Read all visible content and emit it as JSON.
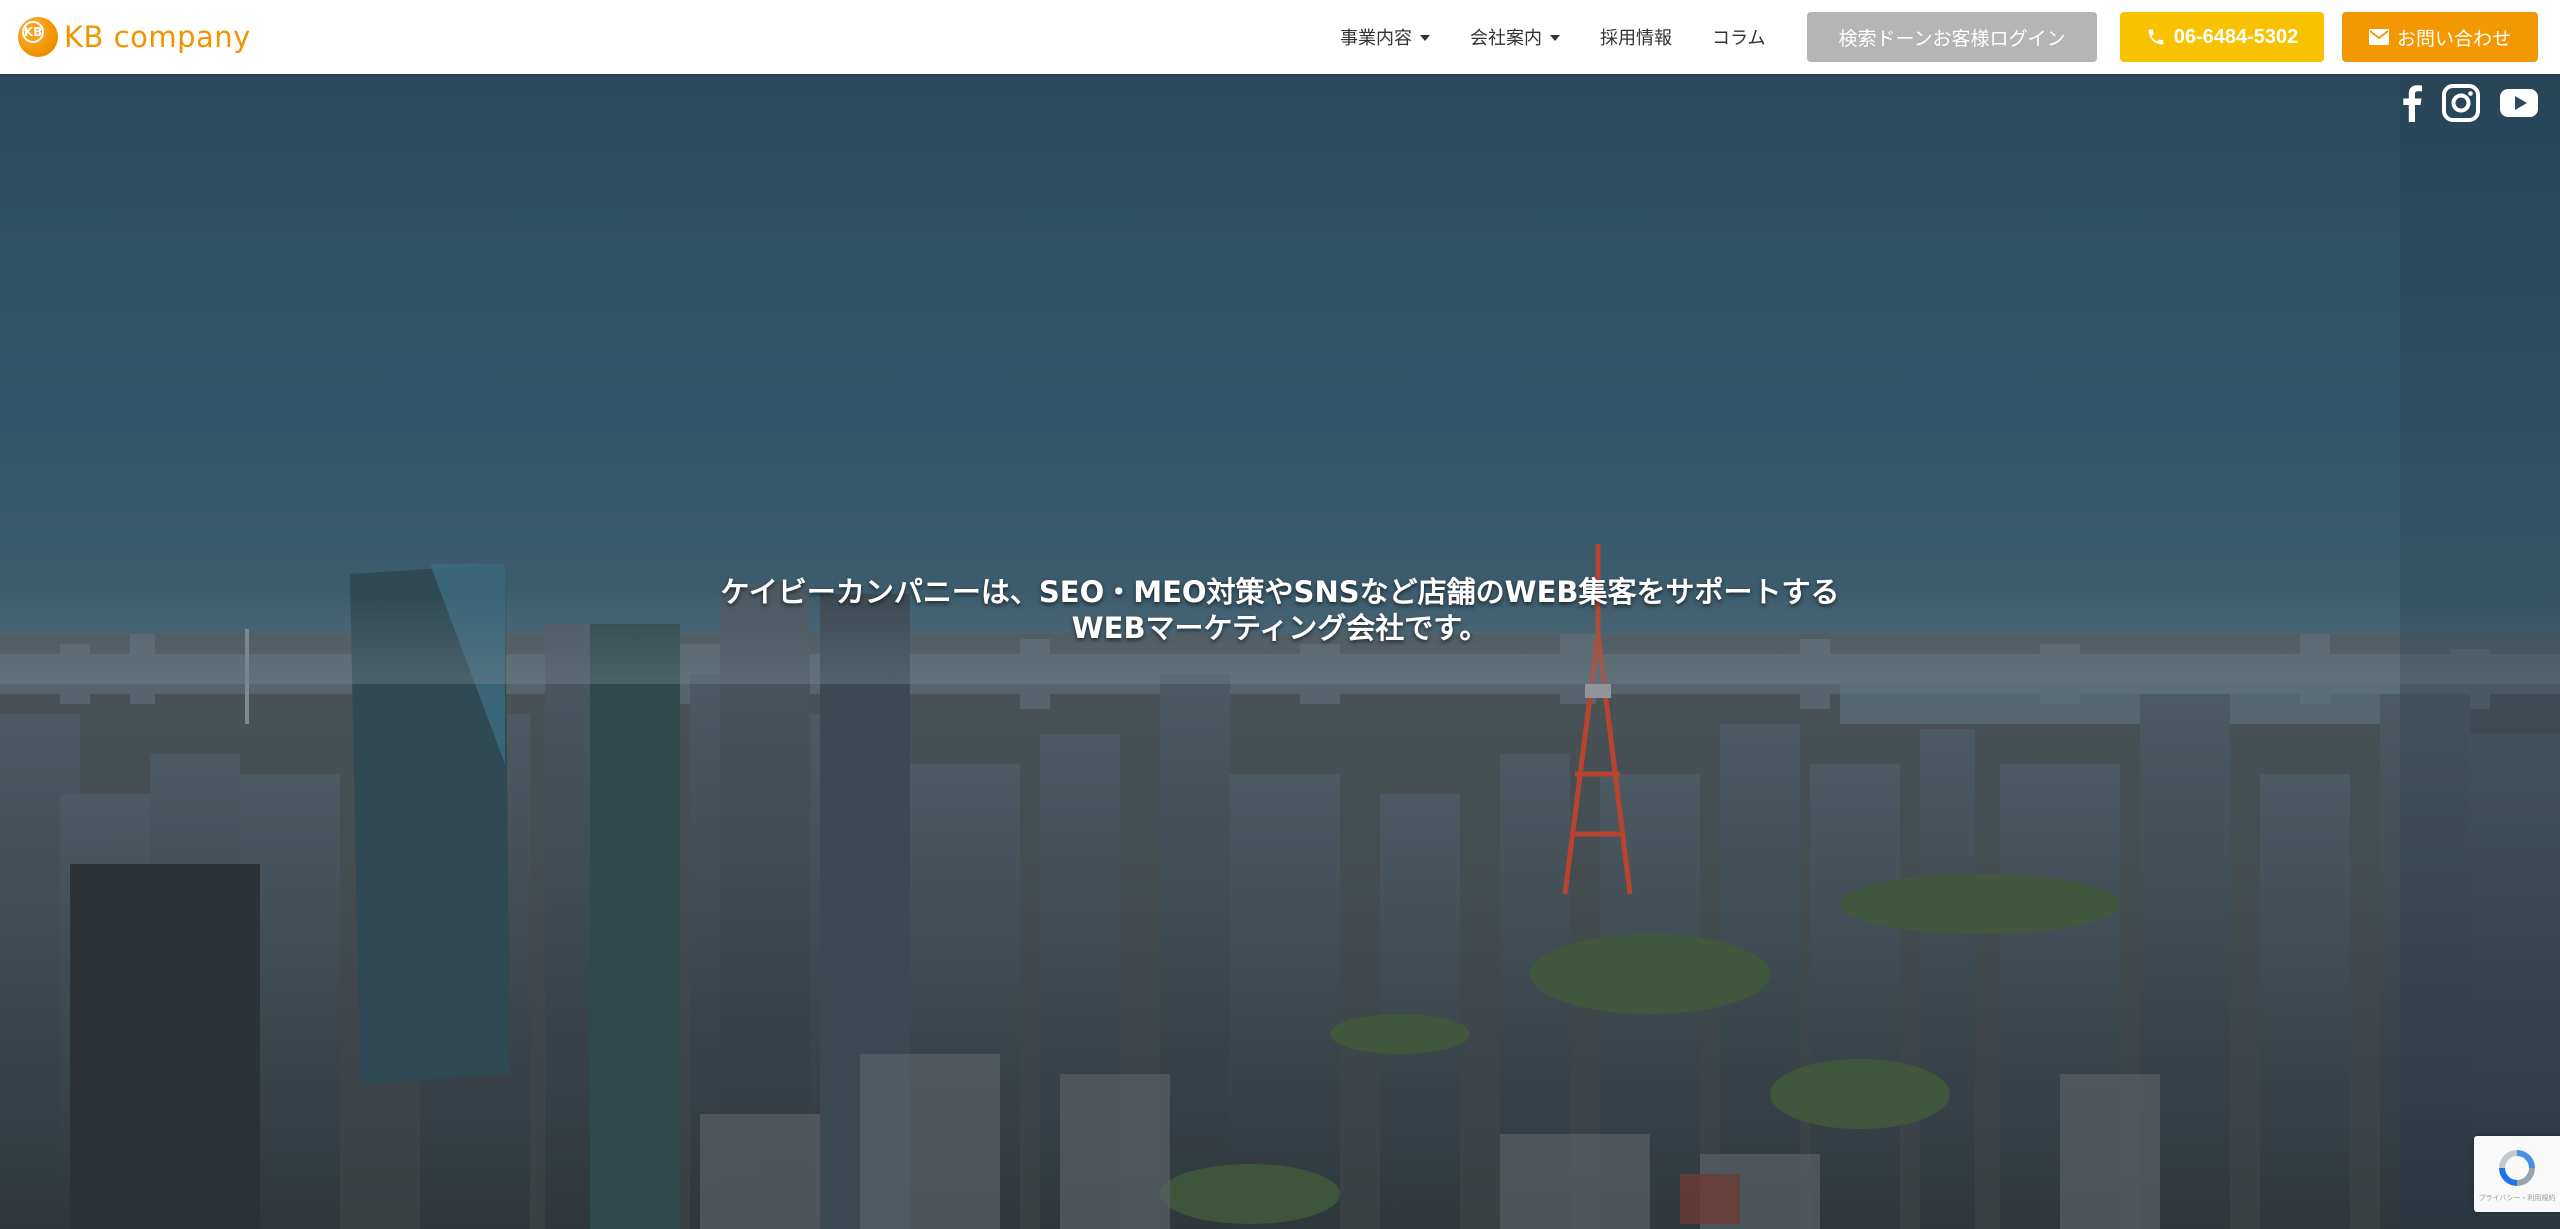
{
  "header": {
    "logo_mark": "KB",
    "logo_text": "KB company",
    "nav": [
      {
        "label": "事業内容",
        "dropdown": true
      },
      {
        "label": "会社案内",
        "dropdown": true
      },
      {
        "label": "採用情報",
        "dropdown": false
      },
      {
        "label": "コラム",
        "dropdown": false
      }
    ],
    "login_button": "検索ドーンお客様ログイン",
    "phone_button": "06-6484-5302",
    "contact_button": "お問い合わせ"
  },
  "hero": {
    "line1": "ケイビーカンパニーは、SEO・MEO対策やSNSなど店舗のWEB集客をサポートする",
    "line2": "WEBマーケティング会社です。"
  },
  "social": [
    "facebook-icon",
    "instagram-icon",
    "youtube-icon"
  ],
  "recaptcha": {
    "text": "プライバシー・利用規約"
  },
  "colors": {
    "brand_orange": "#f29400",
    "phone_yellow": "#f8c200",
    "contact_orange": "#f39800",
    "login_gray": "#b5b5b5"
  }
}
